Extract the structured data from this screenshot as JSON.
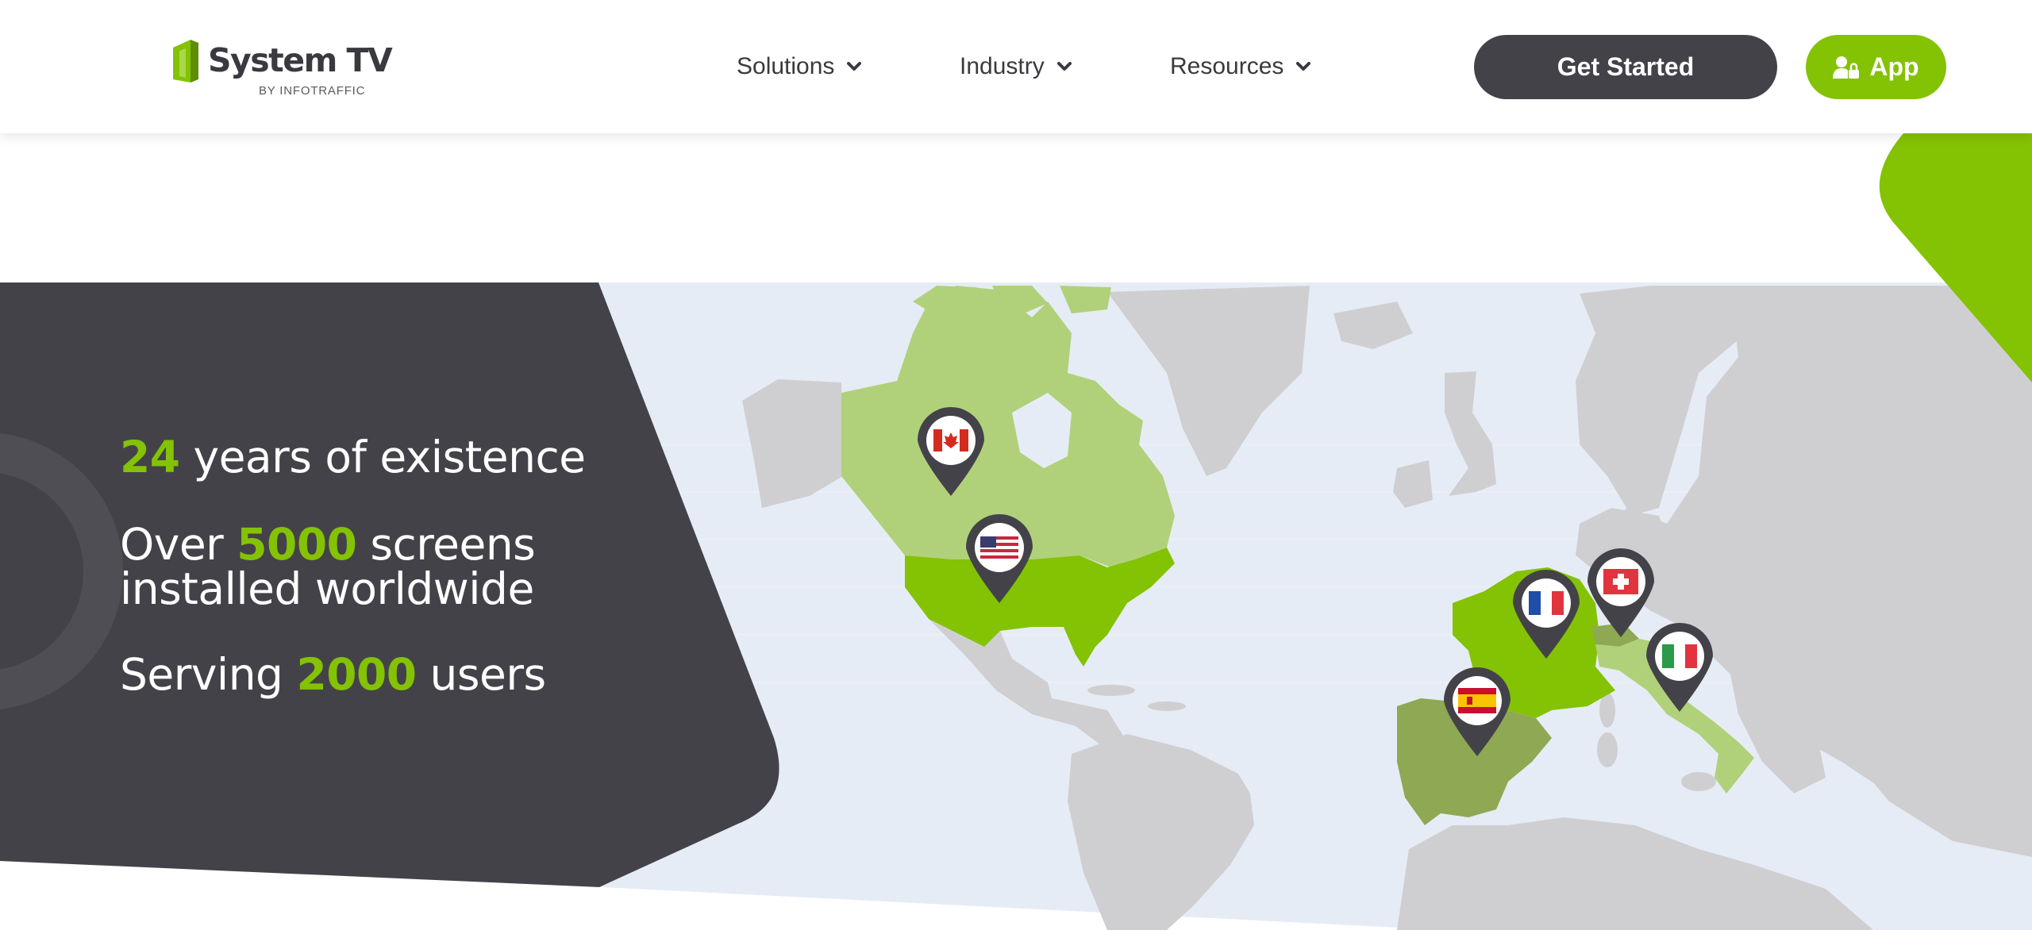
{
  "brand": {
    "name": "System TV",
    "byline": "BY INFOTRAFFIC",
    "accent_color": "#84c204",
    "dark_color": "#444249"
  },
  "nav": {
    "items": [
      {
        "label": "Solutions",
        "icon": "chevron-down-icon"
      },
      {
        "label": "Industry",
        "icon": "chevron-down-icon"
      },
      {
        "label": "Resources",
        "icon": "chevron-down-icon"
      }
    ]
  },
  "actions": {
    "get_started_label": "Get Started",
    "app_label": "App",
    "app_icon": "user-lock-icon"
  },
  "stats": {
    "years": {
      "value": "24",
      "text": " years of existence"
    },
    "screens": {
      "prefix": "Over ",
      "value": "5000",
      "text": " screens",
      "line2": "installed worldwide"
    },
    "users": {
      "prefix": "Serving ",
      "value": "2000",
      "text": " users"
    }
  },
  "map": {
    "pins": [
      {
        "country": "Canada",
        "flag": "canada-flag-icon"
      },
      {
        "country": "USA",
        "flag": "usa-flag-icon"
      },
      {
        "country": "France",
        "flag": "france-flag-icon"
      },
      {
        "country": "Switzerland",
        "flag": "switzerland-flag-icon"
      },
      {
        "country": "Italy",
        "flag": "italy-flag-icon"
      },
      {
        "country": "Spain",
        "flag": "spain-flag-icon"
      }
    ]
  }
}
